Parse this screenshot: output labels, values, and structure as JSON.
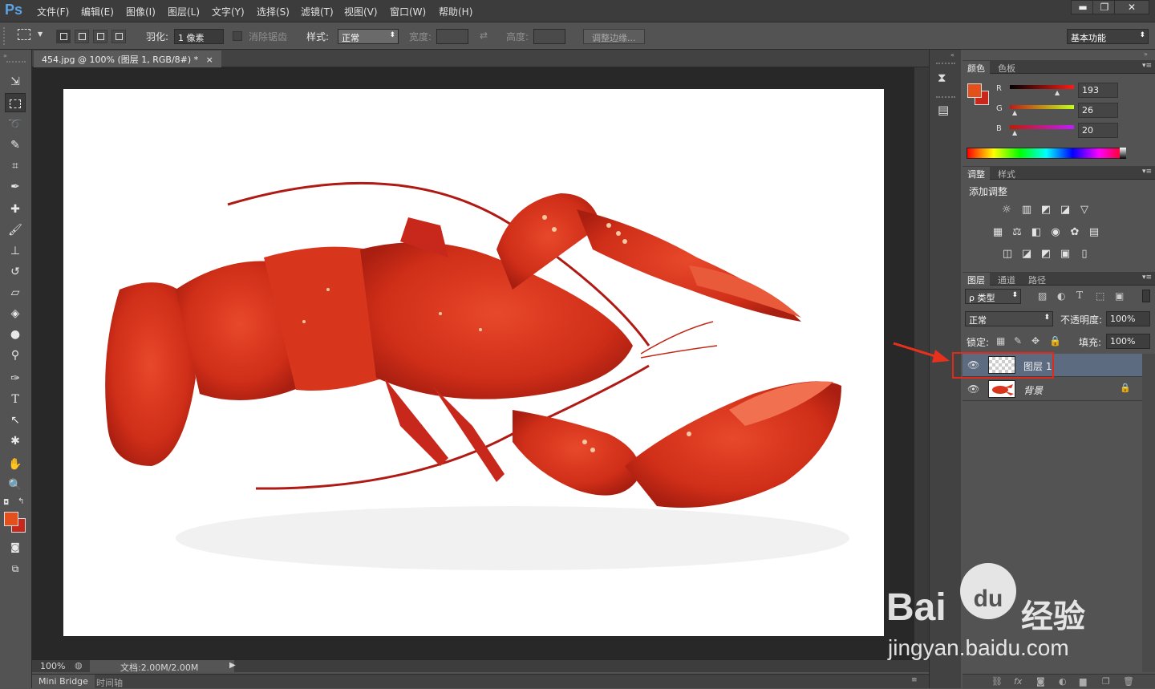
{
  "app": {
    "logo": "Ps"
  },
  "menu": [
    "文件(F)",
    "编辑(E)",
    "图像(I)",
    "图层(L)",
    "文字(Y)",
    "选择(S)",
    "滤镜(T)",
    "视图(V)",
    "窗口(W)",
    "帮助(H)"
  ],
  "window_controls": {
    "minimize": "▬",
    "restore": "❐",
    "close": "✕"
  },
  "options": {
    "feather_label": "羽化:",
    "feather_value": "1 像素",
    "antialias_label": "消除锯齿",
    "style_label": "样式:",
    "style_value": "正常",
    "width_label": "宽度:",
    "height_label": "高度:",
    "refine_edge": "调整边缘...",
    "workspace": "基本功能"
  },
  "document": {
    "tab_title": "454.jpg @ 100% (图层 1, RGB/8#) *",
    "tab_close": "×",
    "zoom": "100%",
    "doc_info": "文档:2.00M/2.00M",
    "bottom_tabs": [
      "Mini Bridge",
      "时间轴"
    ]
  },
  "color_panel": {
    "tabs": [
      "颜色",
      "色板"
    ],
    "r_label": "R",
    "g_label": "G",
    "b_label": "B",
    "r": "193",
    "g": "26",
    "b": "20",
    "foreground": "#c1561a",
    "background": "#c8281c"
  },
  "adjust_panel": {
    "tabs": [
      "调整",
      "样式"
    ],
    "title": "添加调整",
    "row1": [
      "☼",
      "▥",
      "◩",
      "◪",
      "▽"
    ],
    "row2": [
      "▦",
      "⚖",
      "◧",
      "◉",
      "✿",
      "▤"
    ],
    "row3": [
      "◫",
      "◪",
      "◩",
      "▣",
      "▯"
    ]
  },
  "layers_panel": {
    "tabs": [
      "图层",
      "通道",
      "路径"
    ],
    "filter_kind": "ρ 类型",
    "blend_mode": "正常",
    "opacity_label": "不透明度:",
    "opacity": "100%",
    "lock_label": "锁定:",
    "fill_label": "填充:",
    "fill": "100%",
    "layers": [
      {
        "name": "图层 1",
        "selected": true
      },
      {
        "name": "背景",
        "locked": true
      }
    ],
    "footer_icons": [
      "⛓",
      "fx",
      "◙",
      "◐",
      "▆",
      "❐",
      "🗑"
    ]
  },
  "watermark": {
    "brand": "Bai",
    "brand2": "经验",
    "url": "jingyan.baidu.com"
  }
}
